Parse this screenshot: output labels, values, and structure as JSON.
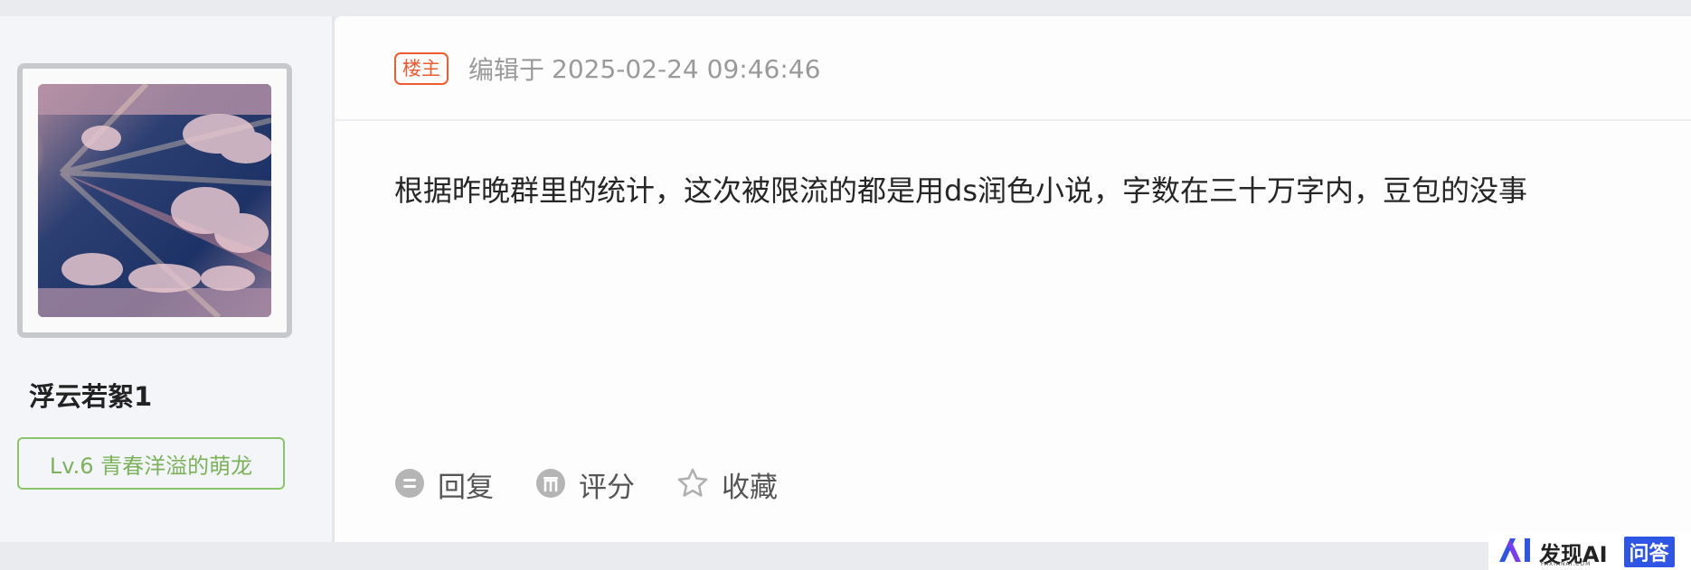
{
  "author": {
    "username": "浮云若絮1",
    "level_badge": "Lv.6 青春洋溢的萌龙"
  },
  "post": {
    "op_tag": "楼主",
    "edit_label": "编辑于",
    "edit_time": "2025-02-24 09:46:46",
    "body": "根据昨晚群里的统计，这次被限流的都是用ds润色小说，字数在三十万字内，豆包的没事"
  },
  "actions": {
    "reply_label": "回复",
    "rate_label": "评分",
    "favorite_label": "收藏"
  },
  "watermark": {
    "brand": "发现AI",
    "sub": "FAXIANAI.COM",
    "qa": "问答"
  },
  "colors": {
    "op_tag": "#ee5b2f",
    "level_badge": "#7cb35a",
    "watermark_accent": "#2f55e4"
  }
}
